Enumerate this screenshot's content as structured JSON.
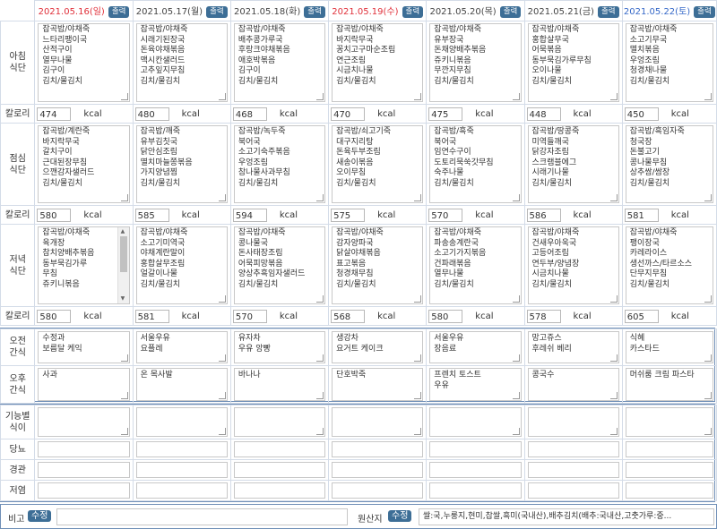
{
  "print_label": "출력",
  "edit_label": "수정",
  "kcal_unit": "kcal",
  "days": [
    {
      "date": "2021.05.16(일)",
      "type": "sun"
    },
    {
      "date": "2021.05.17(월)",
      "type": "wk"
    },
    {
      "date": "2021.05.18(화)",
      "type": "wk"
    },
    {
      "date": "2021.05.19(수)",
      "type": "sun"
    },
    {
      "date": "2021.05.20(목)",
      "type": "wk"
    },
    {
      "date": "2021.05.21(금)",
      "type": "wk"
    },
    {
      "date": "2021.05.22(토)",
      "type": "sat"
    }
  ],
  "meals": {
    "breakfast_label": "아침\n식단",
    "lunch_label": "점심\n식단",
    "dinner_label": "저녁\n식단",
    "calorie_label": "칼로리",
    "breakfast": [
      "잡곡밥/야채죽\n느타리팽이국\n산적구이\n열무나물\n김구이\n김치/물김치",
      "잡곡밥/야채죽\n시래기된장국\n돈육야채볶음\n맥시칸샐러드\n고추잎지무침\n김치/물김치",
      "잡곡밥/야채죽\n배추콩가루국\n후랑크야채볶음\n애호박볶음\n김구이\n김치/물김치",
      "잡곡밥/야채죽\n바지락무국\n꽁치고구마순조림\n연근조림\n시금치나물\n김치/물김치",
      "잡곡밥/야채죽\n유부장국\n돈채양배추볶음\n쥬키니볶음\n무깐지무침\n김치/물김치",
      "잡곡밥/야채죽\n홍합살무국\n어묵볶음\n동부묵김가루무침\n오이나물\n김치/물김치",
      "잡곡밥/야채죽\n소고기무국\n멸치볶음\n우엉조림\n청경채나물\n김치/물김치"
    ],
    "breakfast_kcal": [
      "474",
      "480",
      "468",
      "470",
      "475",
      "448",
      "450"
    ],
    "lunch": [
      "잡곡밥/계란죽\n바지락무국\n갈치구이\n근대된장무침\n으깬감자샐러드\n김치/물김치",
      "잡곡밥/깨죽\n유부김칫국\n닭안심조림\n멸치마늘쫑볶음\n가지양념찜\n김치/물김치",
      "잡곡밥/녹두죽\n북어국\n소고기숙주볶음\n우엉조림\n참나물사과무침\n김치/물김치",
      "잡곡밥/쇠고기죽\n대구지리탕\n돈육두부조림\n새송이볶음\n오이무침\n김치/물김치",
      "잡곡밥/흑죽\n북어국\n임연수구이\n도토리묵쑥갓무침\n숙주나물\n김치/물김치",
      "잡곡밥/땅콩죽\n미역들깨국\n닭강자조림\n스크램블에그\n시래기나물\n김치/물김치",
      "잡곡밥/흑임자죽\n청국장\n돈불고기\n콩나물무침\n상추쌈/쌈장\n김치/물김치"
    ],
    "lunch_kcal": [
      "580",
      "585",
      "594",
      "575",
      "570",
      "586",
      "581"
    ],
    "dinner": [
      "잡곡밥/야채죽\n육개장\n참치양배추볶음\n동부묵김가루\n무침\n쥬키니볶음",
      "잡곡밥/야채죽\n소고기미역국\n야채계란말이\n홍합살무조림\n얼갈이나물\n김치/물김치",
      "잡곡밥/야채죽\n콩나물국\n돈사태장조림\n어묵피망볶음\n양상추흑임자샐러드\n김치/물김치",
      "잡곡밥/야채죽\n감자양파국\n닭살야채볶음\n표고볶음\n청경채무침\n김치/물김치",
      "잡곡밥/야채죽\n파송송계란국\n소고기가지볶음\n건파래볶음\n열무나물\n김치/물김치",
      "잡곡밥/야채죽\n건새우아욱국\n고등어조림\n연두부/양념장\n시금치나물\n김치/물김치",
      "잡곡밥/야채죽\n팽이장국\n카레라이스\n생선까스/타르소스\n단무지무침\n김치/물김치"
    ],
    "dinner_kcal": [
      "580",
      "581",
      "570",
      "568",
      "580",
      "578",
      "605"
    ]
  },
  "snacks": {
    "am_label": "오전\n간식",
    "pm_label": "오후\n간식",
    "am": [
      "수정과\n보름달 케익",
      "서울우유\n요플레",
      "유자차\n우유 앙빵",
      "생강차\n요거트 케이크",
      "서울우유\n장음료",
      "망고쥬스\n후레쉬 베리",
      "식혜\n카스타드"
    ],
    "pm": [
      "사과",
      "온 목사발",
      "바나나",
      "단호박죽",
      "프렌치 토스트\n우유",
      "콩국수",
      "머쉬룸 크림 파스타"
    ]
  },
  "special": {
    "functional_label": "기능별\n식이",
    "diabetes_label": "당뇨",
    "tube_label": "경관",
    "lowsalt_label": "저염"
  },
  "footer": {
    "remarks_label": "비고",
    "origin_label": "원산지",
    "origin_text": "쌀:국,누룽지,현미,찹쌀,흑미(국내산),배추김치(배추:국내산,고춧가루:중..."
  }
}
